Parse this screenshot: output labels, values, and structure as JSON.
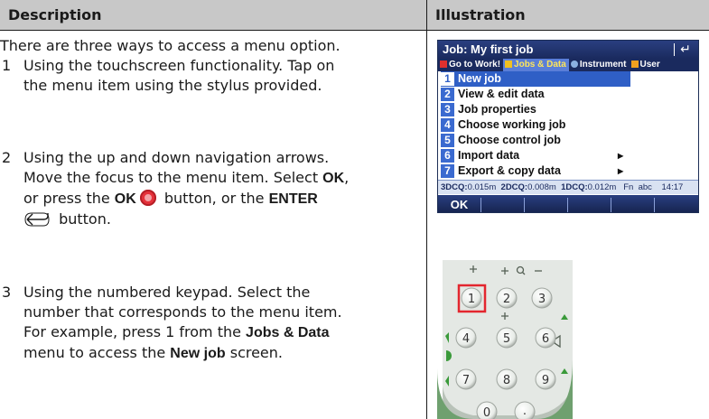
{
  "table": {
    "headers": {
      "description": "Description",
      "illustration": "Illustration"
    },
    "intro": "There are three ways to access a menu option.",
    "items": [
      {
        "number": "1",
        "line1": "Using the touchscreen functionality. Tap on",
        "line2": "the menu item using the stylus provided."
      },
      {
        "number": "2",
        "line1": "Using the up and down navigation arrows.",
        "line2_pre": "Move the focus to the menu item. Select ",
        "line2_ok": "OK",
        "line2_post": ",",
        "line3_pre": "or press the ",
        "line3_ok": "OK",
        "line3_mid": " button, or the ",
        "line3_enter": "ENTER",
        "line4": " button."
      },
      {
        "number": "3",
        "line1": "Using the numbered keypad. Select the",
        "line2": "number that corresponds to the menu item.",
        "line3_pre": "For example, press 1 from the ",
        "line3_b": "Jobs & Data",
        "line4_b": "menu",
        "line4_mid": " to access the ",
        "line4_b2": "New job",
        "line4_post": " screen."
      }
    ]
  },
  "screenshot": {
    "title": "Job: My first job",
    "tabs": [
      {
        "label": "Go to Work!",
        "color": "#e0302e",
        "active": false
      },
      {
        "label": "Jobs & Data",
        "color": "#f0c020",
        "active": true
      },
      {
        "label": "Instrument",
        "color": "#8ab0e0",
        "active": false
      },
      {
        "label": "User",
        "color": "#f0a020",
        "active": false
      }
    ],
    "menu": [
      {
        "num": "1",
        "label": "New job",
        "submenu": false,
        "selected": true
      },
      {
        "num": "2",
        "label": "View & edit data",
        "submenu": false,
        "selected": false
      },
      {
        "num": "3",
        "label": "Job properties",
        "submenu": false,
        "selected": false
      },
      {
        "num": "4",
        "label": "Choose working job",
        "submenu": false,
        "selected": false
      },
      {
        "num": "5",
        "label": "Choose control job",
        "submenu": false,
        "selected": false
      },
      {
        "num": "6",
        "label": "Import data",
        "submenu": true,
        "selected": false
      },
      {
        "num": "7",
        "label": "Export & copy data",
        "submenu": true,
        "selected": false
      }
    ],
    "status": {
      "q3_label": "3DCQ:",
      "q3_value": "0.015m",
      "q2_label": "2DCQ:",
      "q2_value": "0.008m",
      "q1_label": "1DCQ:",
      "q1_value": "0.012m",
      "fn": "Fn",
      "mode": "abc",
      "time": "14:17"
    },
    "softkeys": [
      "OK",
      "",
      "",
      "",
      "",
      ""
    ]
  },
  "keypad": {
    "keys": [
      "1",
      "2",
      "3",
      "4",
      "5",
      "6",
      "7",
      "8",
      "9",
      "0",
      "."
    ],
    "highlighted": "1",
    "highlight_color": "#e3262f"
  },
  "colors": {
    "header_bg": "#c8c8c8",
    "screen_title": "#1a2a5e",
    "selection": "#2f5fc6",
    "ok_key": "#e5313a"
  }
}
